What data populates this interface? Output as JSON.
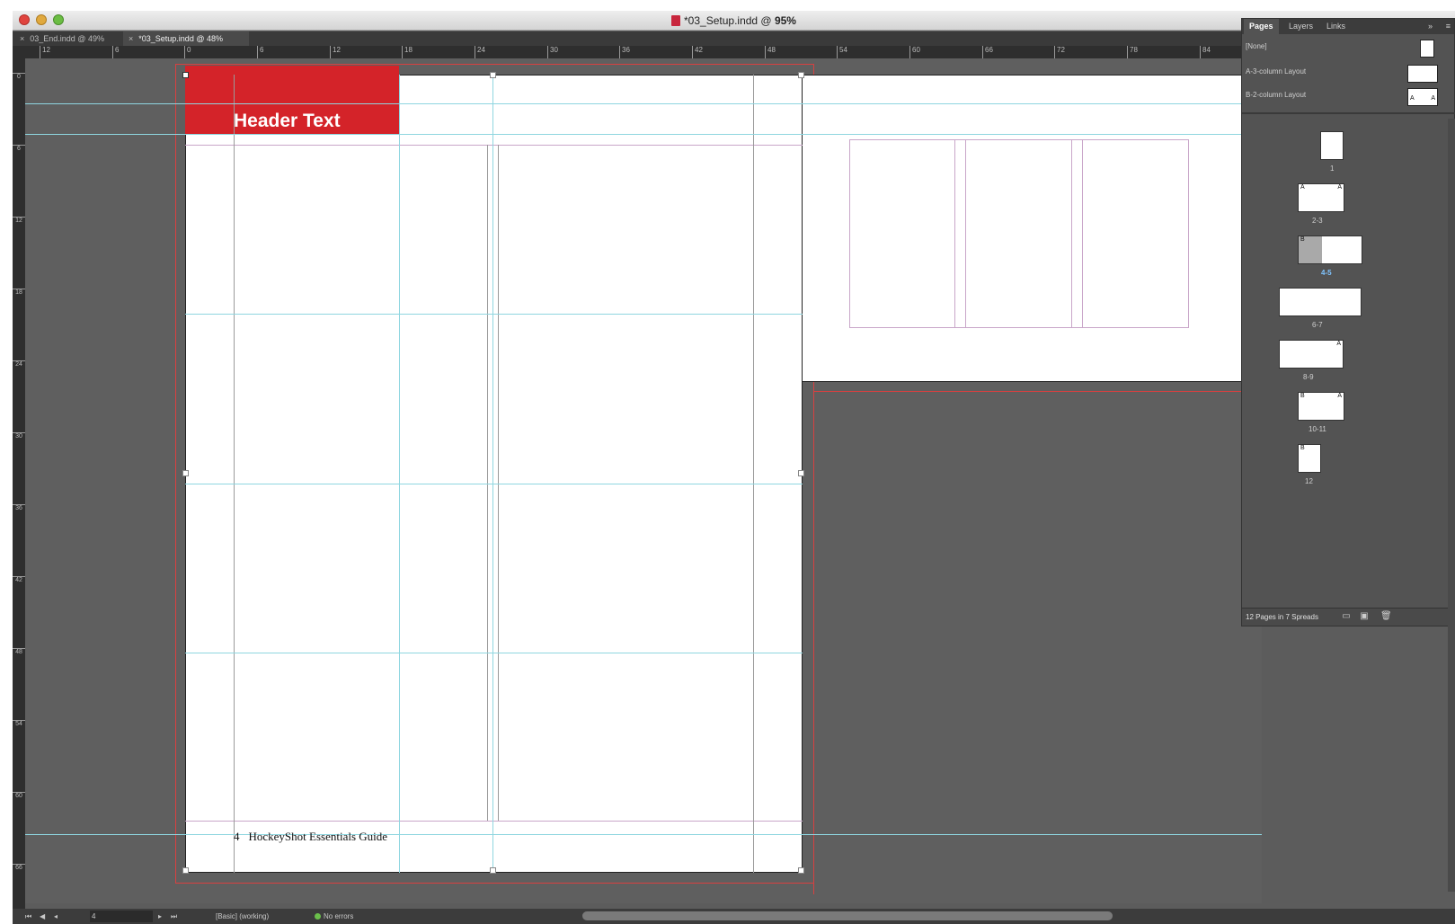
{
  "window": {
    "title_prefix": "*03_Setup.indd @ ",
    "title_zoom": "95%"
  },
  "tabs": [
    {
      "label": "03_End.indd @ 49%",
      "close": "×"
    },
    {
      "label": "*03_Setup.indd @ 48%",
      "close": "×"
    }
  ],
  "rulers": {
    "h": [
      "12",
      "6",
      "0",
      "6",
      "12",
      "18",
      "24",
      "30",
      "36",
      "42",
      "48",
      "54",
      "60",
      "66",
      "72",
      "78",
      "84"
    ],
    "v": [
      "0",
      "6",
      "12",
      "18",
      "24",
      "30",
      "36",
      "42",
      "48",
      "54",
      "60",
      "66"
    ]
  },
  "document": {
    "header_text": "Header Text",
    "folio_number": "4",
    "folio_text": "HockeyShot Essentials Guide"
  },
  "panel": {
    "tabs": {
      "pages": "Pages",
      "layers": "Layers",
      "links": "Links"
    },
    "menu_glyph": "»",
    "more_glyph": "≡",
    "masters": [
      {
        "label": "[None]"
      },
      {
        "label": "A-3-column Layout",
        "left": "",
        "right": ""
      },
      {
        "label": "B-2-column Layout",
        "left": "A",
        "right": "A"
      }
    ],
    "spreads": [
      {
        "label": "1",
        "left_badge": "",
        "right_badge": ""
      },
      {
        "label": "2-3",
        "left_badge": "A",
        "right_badge": "A"
      },
      {
        "label": "4-5",
        "left_badge": "B",
        "right_badge": ""
      },
      {
        "label": "6-7",
        "left_badge": "",
        "right_badge": ""
      },
      {
        "label": "8-9",
        "left_badge": "",
        "right_badge": "A"
      },
      {
        "label": "10-11",
        "left_badge": "B",
        "right_badge": "A"
      },
      {
        "label": "12",
        "left_badge": "B",
        "right_badge": ""
      }
    ],
    "footer": "12 Pages in 7 Spreads",
    "footer_icons": [
      "new-master-icon",
      "new-page-icon",
      "trash-icon"
    ]
  },
  "statusbar": {
    "page": "4",
    "style": "[Basic] (working)",
    "errors": "No errors"
  },
  "colors": {
    "header_red": "#d42329",
    "guide_cyan": "#8fd6e0",
    "margin_magenta": "#c9a6c9",
    "bleed_red": "#d84040",
    "selected_spread_blue": "#7fc4ff"
  }
}
